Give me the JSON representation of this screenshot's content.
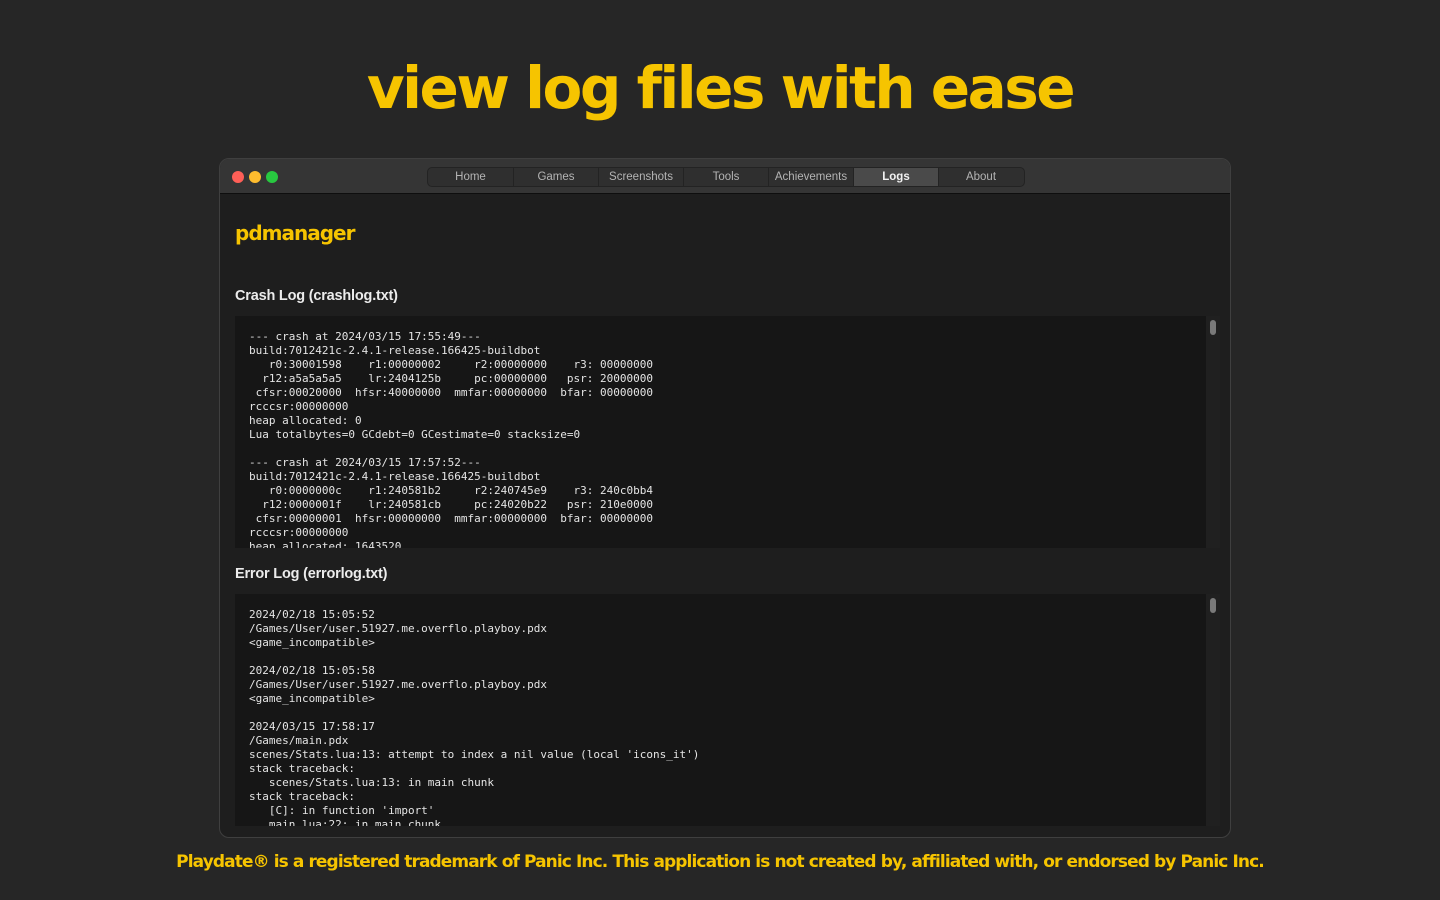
{
  "hero": {
    "title": "view log files with ease"
  },
  "window": {
    "tabs": [
      {
        "label": "Home"
      },
      {
        "label": "Games"
      },
      {
        "label": "Screenshots"
      },
      {
        "label": "Tools"
      },
      {
        "label": "Achievements"
      },
      {
        "label": "Logs"
      },
      {
        "label": "About"
      }
    ],
    "active_tab": "Logs"
  },
  "app": {
    "brand": "pdmanager"
  },
  "crash_log": {
    "title": "Crash Log (crashlog.txt)",
    "content": "--- crash at 2024/03/15 17:55:49---\nbuild:7012421c-2.4.1-release.166425-buildbot\n   r0:30001598    r1:00000002     r2:00000000    r3: 00000000\n  r12:a5a5a5a5    lr:2404125b     pc:00000000   psr: 20000000\n cfsr:00020000  hfsr:40000000  mmfar:00000000  bfar: 00000000\nrcccsr:00000000\nheap allocated: 0\nLua totalbytes=0 GCdebt=0 GCestimate=0 stacksize=0\n\n--- crash at 2024/03/15 17:57:52---\nbuild:7012421c-2.4.1-release.166425-buildbot\n   r0:0000000c    r1:240581b2     r2:240745e9    r3: 240c0bb4\n  r12:0000001f    lr:240581cb     pc:24020b22   psr: 210e0000\n cfsr:00000001  hfsr:00000000  mmfar:00000000  bfar: 00000000\nrcccsr:00000000\nheap allocated: 1643520"
  },
  "error_log": {
    "title": "Error Log (errorlog.txt)",
    "content": "2024/02/18 15:05:52\n/Games/User/user.51927.me.overflo.playboy.pdx\n<game_incompatible>\n\n2024/02/18 15:05:58\n/Games/User/user.51927.me.overflo.playboy.pdx\n<game_incompatible>\n\n2024/03/15 17:58:17\n/Games/main.pdx\nscenes/Stats.lua:13: attempt to index a nil value (local 'icons_it')\nstack traceback:\n   scenes/Stats.lua:13: in main chunk\nstack traceback:\n   [C]: in function 'import'\n   main.lua:22: in main chunk"
  },
  "footer": {
    "disclaimer": "Playdate® is a registered trademark of Panic Inc. This application is not created by, affiliated with, or endorsed by Panic Inc."
  },
  "colors": {
    "accent": "#f6c400",
    "background": "#262626",
    "window_bg": "#1e1e1e",
    "panel_bg": "#161616"
  }
}
